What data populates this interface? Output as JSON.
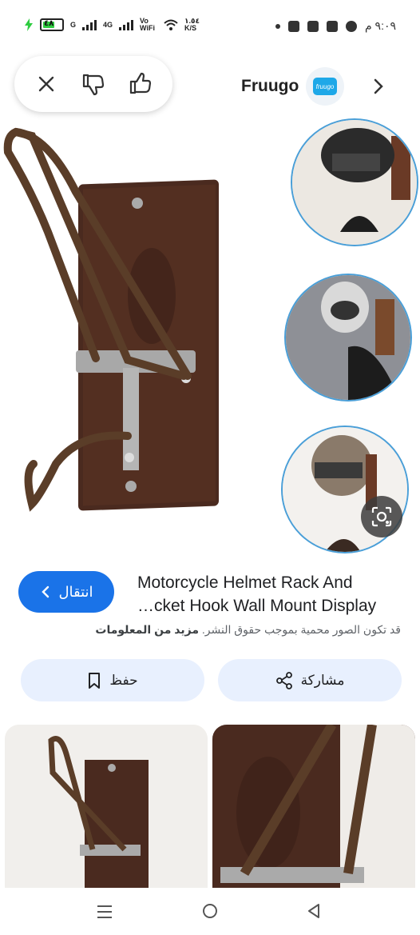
{
  "status_bar": {
    "battery_level": "٤٨",
    "network_1": "G",
    "network_2": "4G",
    "volte": "Vo WiFi",
    "speed": "١.٥٤ K/S",
    "time": "٩:٠٩ م"
  },
  "actions": {
    "close_icon": "close-icon",
    "dislike_icon": "thumbs-down-icon",
    "like_icon": "thumbs-up-icon"
  },
  "source": {
    "name": "Fruugo",
    "logo_text": "fruugo"
  },
  "product": {
    "title_line1": "Motorcycle Helmet Rack And",
    "title_line2": "…cket Hook Wall Mount Display",
    "visit_label": "انتقال",
    "copyright_text": "قد تكون الصور محمية بموجب حقوق النشر.",
    "more_info_label": "مزيد من المعلومات"
  },
  "buttons": {
    "share_label": "مشاركة",
    "save_label": "حفظ"
  },
  "colors": {
    "accent": "#1a73e8",
    "pill_bg": "#e8f0fe",
    "wood": "#4a2a1f",
    "metal": "#b8b8b8",
    "bronze": "#5a3d28"
  }
}
